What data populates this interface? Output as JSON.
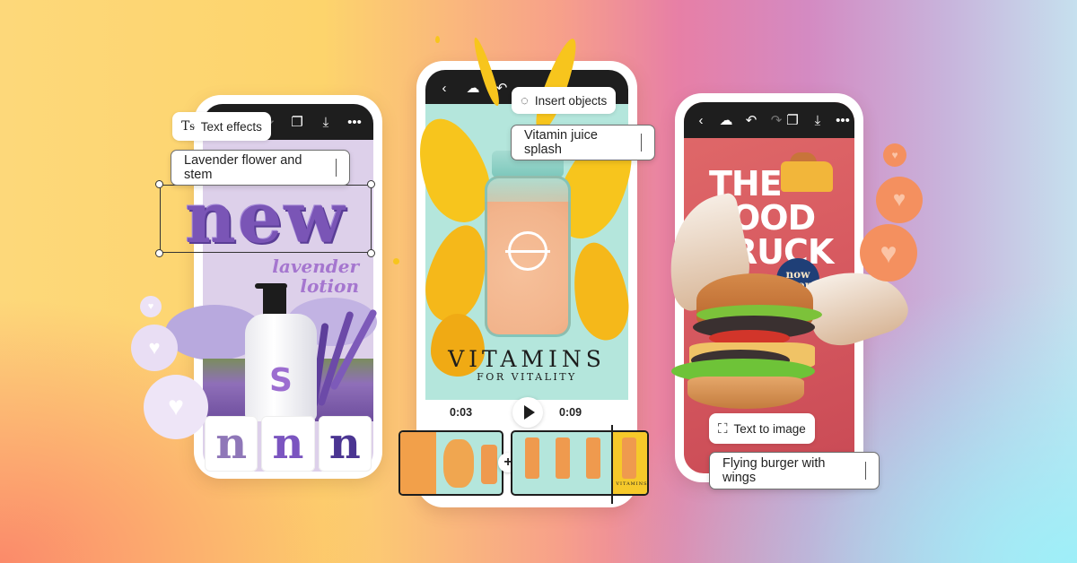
{
  "colors": {
    "toolbar_bg": "#1e1e1e",
    "lavender": "#7a55b6",
    "vitamin_bg": "#b4e6dc",
    "splash_yellow": "#f7c51d",
    "foodtruck_red": "#d85b61",
    "now_open_blue": "#1f3f77",
    "heart_bubble_lavender": "#e7dcf3",
    "heart_bubble_orange": "#f4905f"
  },
  "phone_left": {
    "toolbar_icons": [
      "redo-icon",
      "pages-icon",
      "download-icon",
      "more-icon"
    ],
    "feature_chip": {
      "icon": "text-effects-icon",
      "label": "Text effects"
    },
    "prompt_field": {
      "value": "Lavender flower and stem"
    },
    "artwork": {
      "headline": "new",
      "subline_1": "lavender",
      "subline_2": "lotion",
      "bottle_logo": "S"
    },
    "variants": [
      "n",
      "n",
      "n"
    ]
  },
  "phone_center": {
    "toolbar_icons": [
      "back-icon",
      "cloud-icon",
      "undo-icon"
    ],
    "feature_chip": {
      "icon": "insert-objects-icon",
      "label": "Insert objects"
    },
    "prompt_field": {
      "value": "Vitamin juice splash"
    },
    "artwork": {
      "title": "VITAMINS",
      "subtitle": "FOR VITALITY"
    },
    "playback": {
      "current_time": "0:03",
      "total_time": "0:09"
    },
    "timeline": {
      "add_label": "+",
      "clip_2_caption": "VITAMINS"
    }
  },
  "phone_right": {
    "toolbar_icons": [
      "back-icon",
      "cloud-icon",
      "undo-icon",
      "redo-icon",
      "pages-icon",
      "download-icon",
      "more-icon"
    ],
    "feature_chip": {
      "icon": "text-to-image-icon",
      "label": "Text to image"
    },
    "prompt_field": {
      "value": "Flying burger with wings"
    },
    "artwork": {
      "title_line_1": "THE",
      "title_line_2": "FOOD",
      "title_line_3": "TRUCK",
      "badge_line_1": "now",
      "badge_line_2": "open"
    }
  },
  "glyphs": {
    "back": "‹",
    "cloud": "☁",
    "undo": "↶",
    "redo": "↷",
    "pages": "❐",
    "download": "⤓",
    "more": "•••",
    "heart": "♥",
    "text_effects": "Tᵴ",
    "insert": "◌",
    "text_to_image": "⛶"
  }
}
